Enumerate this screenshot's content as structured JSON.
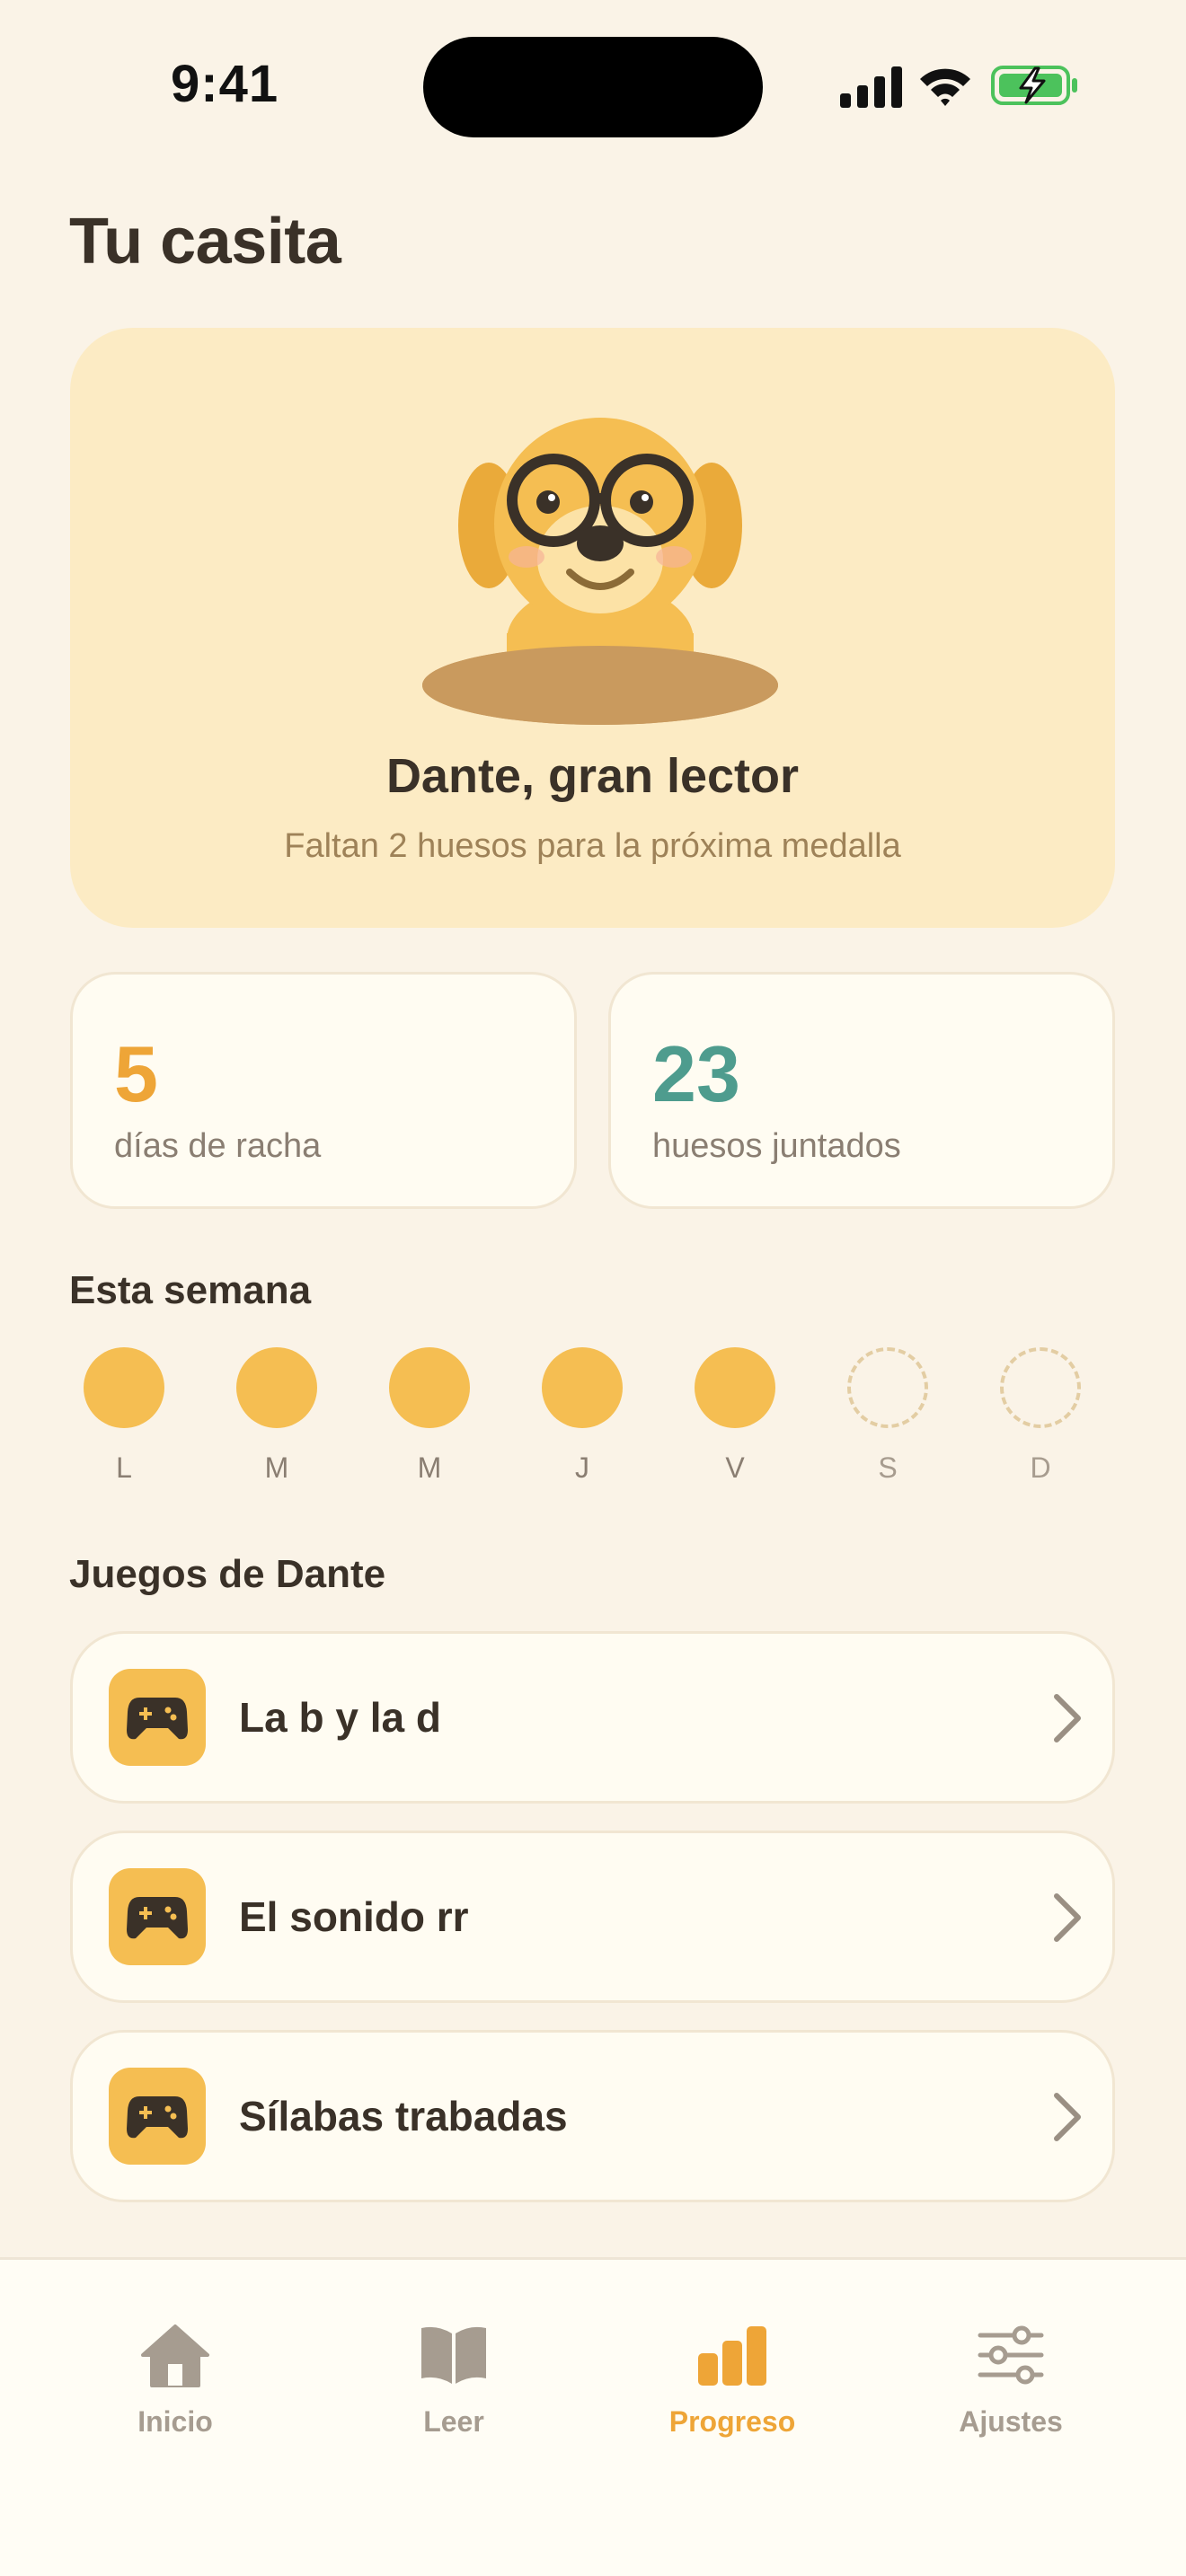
{
  "status_bar": {
    "time": "9:41"
  },
  "page_title": "Tu casita",
  "hero": {
    "name": "Dante, gran lector",
    "subtitle": "Faltan 2 huesos para la próxima medalla"
  },
  "stats": [
    {
      "value": "5",
      "label": "días de racha",
      "color": "#EEA537"
    },
    {
      "value": "23",
      "label": "huesos juntados",
      "color": "#4E9C8E"
    }
  ],
  "week": {
    "title": "Esta semana",
    "days": [
      {
        "label": "L",
        "done": true
      },
      {
        "label": "M",
        "done": true
      },
      {
        "label": "M",
        "done": true
      },
      {
        "label": "J",
        "done": true
      },
      {
        "label": "V",
        "done": true
      },
      {
        "label": "S",
        "done": false
      },
      {
        "label": "D",
        "done": false
      }
    ]
  },
  "games": {
    "title": "Juegos de Dante",
    "items": [
      {
        "label": "La b y la d",
        "icon": "gamepad-icon"
      },
      {
        "label": "El sonido rr",
        "icon": "gamepad-icon"
      },
      {
        "label": "Sílabas trabadas",
        "icon": "gamepad-icon"
      }
    ]
  },
  "tab_bar": {
    "items": [
      {
        "label": "Inicio",
        "icon": "home-icon",
        "active": false
      },
      {
        "label": "Leer",
        "icon": "book-icon",
        "active": false
      },
      {
        "label": "Progreso",
        "icon": "bar-chart-icon",
        "active": true
      },
      {
        "label": "Ajustes",
        "icon": "sliders-icon",
        "active": false
      }
    ]
  },
  "colors": {
    "background": "#FAF3E7",
    "accent": "#EEA537",
    "teal": "#4E9C8E",
    "hero_bg": "#FCEBC4"
  }
}
